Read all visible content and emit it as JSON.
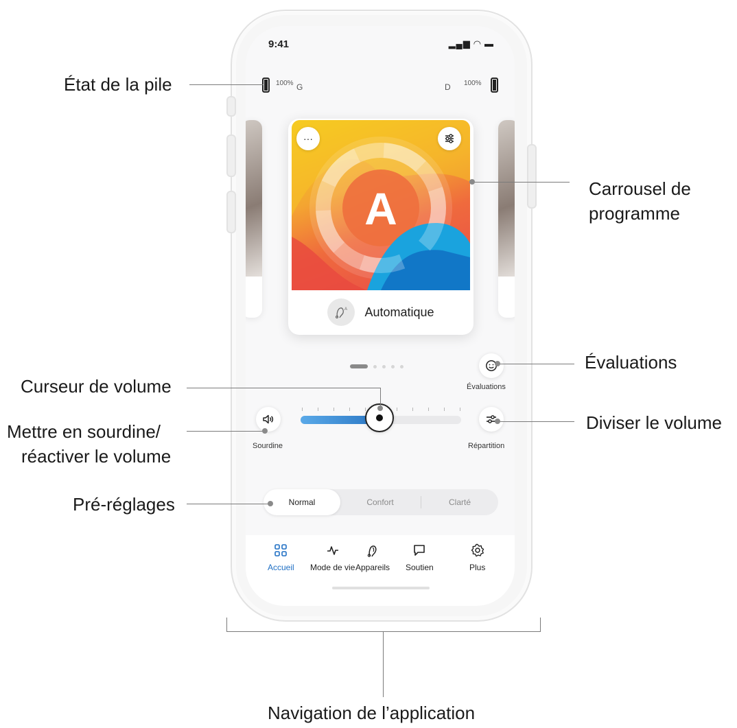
{
  "status_bar": {
    "time": "9:41",
    "icons": "▂▄▆ ◠ ▬"
  },
  "battery": {
    "left_percent": "100%",
    "left_side": "G",
    "right_percent": "100%",
    "right_side": "D"
  },
  "program_card": {
    "letter": "A",
    "name": "Automatique",
    "more_label": "···",
    "settings_label": "⚙"
  },
  "controls": {
    "ratings_label": "Évaluations",
    "mute_label": "Sourdine",
    "split_label": "Répartition",
    "volume_level": 0.5
  },
  "presets": [
    {
      "label": "Normal",
      "selected": true
    },
    {
      "label": "Confort",
      "selected": false
    },
    {
      "label": "Clarté",
      "selected": false
    }
  ],
  "tabs": [
    {
      "label": "Accueil",
      "active": true
    },
    {
      "label": "Mode de vie",
      "active": false
    },
    {
      "label": "Appareils",
      "active": false
    },
    {
      "label": "Soutien",
      "active": false
    },
    {
      "label": "Plus",
      "active": false
    }
  ],
  "callouts": {
    "battery": "État de la pile",
    "carousel_line1": "Carrousel de",
    "carousel_line2": "programme",
    "ratings": "Évaluations",
    "volume_slider": "Curseur de volume",
    "mute_line1": "Mettre en sourdine/",
    "mute_line2": "réactiver le volume",
    "split_volume": "Diviser le volume",
    "presets": "Pré-réglages",
    "navigation": "Navigation de l’application"
  },
  "colors": {
    "accent": "#1f6fc4",
    "slider_start": "#5aa9e8",
    "slider_end": "#2b77c4"
  }
}
